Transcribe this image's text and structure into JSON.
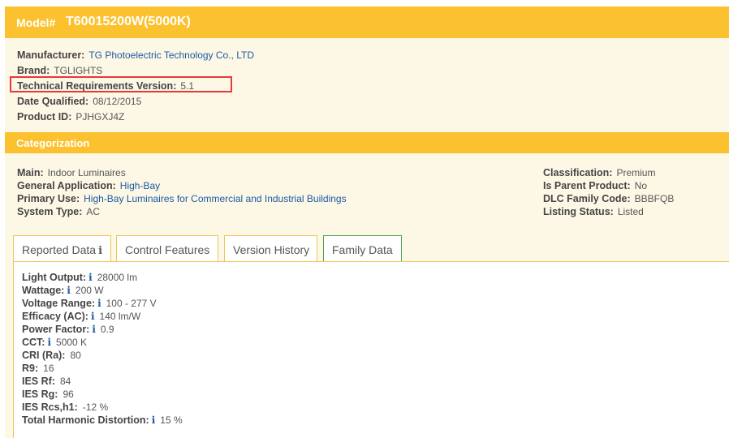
{
  "header": {
    "model_label": "Model#",
    "model_value": "T60015200W(5000K)"
  },
  "info": {
    "manufacturer_label": "Manufacturer:",
    "manufacturer_value": "TG Photoelectric Technology Co., LTD",
    "brand_label": "Brand:",
    "brand_value": "TGLIGHTS",
    "tech_label": "Technical Requirements Version:",
    "tech_value": "5.1",
    "date_label": "Date Qualified:",
    "date_value": "08/12/2015",
    "product_label": "Product ID:",
    "product_value": "PJHGXJ4Z"
  },
  "categorization": {
    "title": "Categorization",
    "main_label": "Main:",
    "main_value": "Indoor Luminaires",
    "general_label": "General Application:",
    "general_value": "High-Bay",
    "primary_label": "Primary Use:",
    "primary_value": "High-Bay Luminaires for Commercial and Industrial Buildings",
    "system_label": "System Type:",
    "system_value": "AC",
    "class_label": "Classification:",
    "class_value": "Premium",
    "parent_label": "Is Parent Product:",
    "parent_value": "No",
    "family_label": "DLC Family Code:",
    "family_value": "BBBFQB",
    "listing_label": "Listing Status:",
    "listing_value": "Listed"
  },
  "tabs": [
    "Reported Data",
    "Control Features",
    "Version History",
    "Family Data"
  ],
  "info_glyph": "i",
  "reported": [
    {
      "label": "Light Output:",
      "value": "28000 lm",
      "icon": true
    },
    {
      "label": "Wattage:",
      "value": "200 W",
      "icon": true
    },
    {
      "label": "Voltage Range:",
      "value": "100 - 277 V",
      "icon": true
    },
    {
      "label": "Efficacy (AC):",
      "value": "140 lm/W",
      "icon": true
    },
    {
      "label": "Power Factor:",
      "value": "0.9",
      "icon": true
    },
    {
      "label": "CCT:",
      "value": "5000 K",
      "icon": true
    },
    {
      "label": "CRI (Ra):",
      "value": "80",
      "icon": false
    },
    {
      "label": "R9:",
      "value": "16",
      "icon": false
    },
    {
      "label": "IES Rf:",
      "value": "84",
      "icon": false
    },
    {
      "label": "IES Rg:",
      "value": "96",
      "icon": false
    },
    {
      "label": "IES Rcs,h1:",
      "value": "-12 %",
      "icon": false
    },
    {
      "label": "Total Harmonic Distortion:",
      "value": "15 %",
      "icon": true
    }
  ]
}
